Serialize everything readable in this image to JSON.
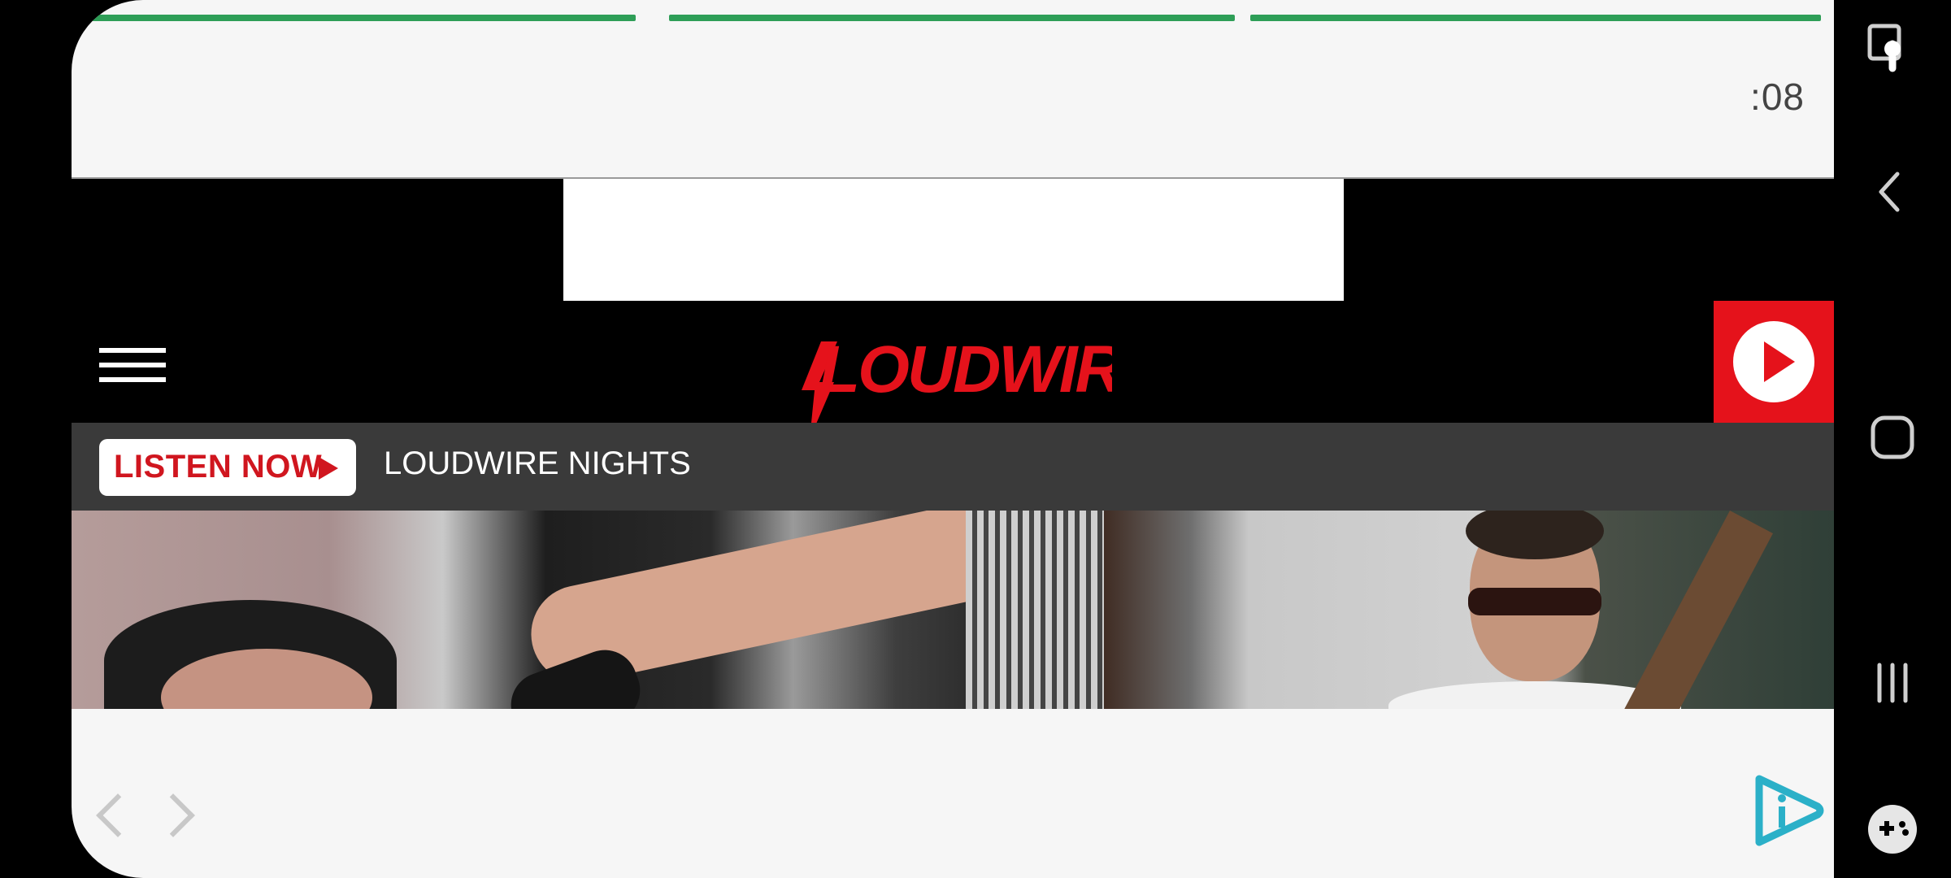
{
  "story": {
    "progress_segments": [
      {
        "fill": 1.0
      },
      {
        "fill": 1.0
      },
      {
        "fill": 1.0
      }
    ],
    "timer": ":08",
    "progress_color": "#2e9e57"
  },
  "header": {
    "logo_text": "LOUDWIRE",
    "brand_color": "#e5121b"
  },
  "listen_bar": {
    "button_label": "LISTEN NOW",
    "station_name": "LOUDWIRE NIGHTS"
  },
  "icons": {
    "menu": "hamburger-menu-icon",
    "play": "play-icon",
    "prev": "chevron-left-icon",
    "next": "chevron-right-icon",
    "brand": "brand-play-icon",
    "system": [
      "screen-pin-icon",
      "back-icon",
      "home-icon",
      "recents-icon",
      "game-tools-icon"
    ]
  }
}
